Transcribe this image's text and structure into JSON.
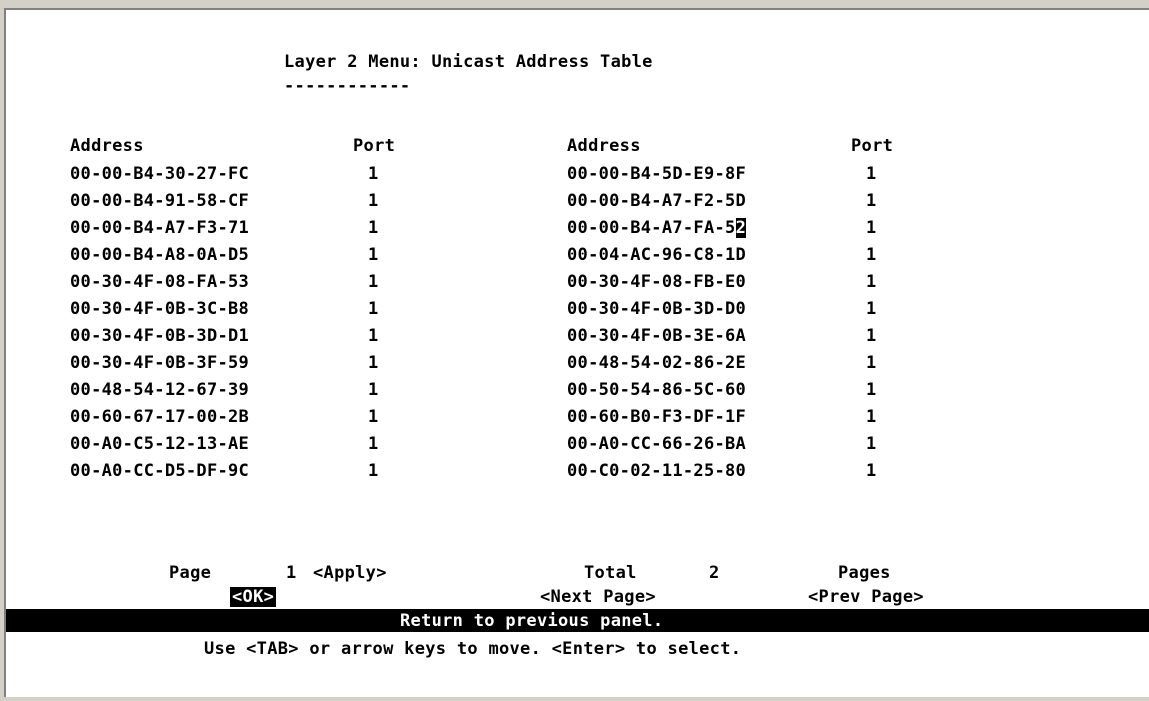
{
  "header": {
    "title": "Layer 2 Menu: Unicast Address Table",
    "underline": "------------"
  },
  "table": {
    "columns": [
      "Address",
      "Port",
      "Address",
      "Port"
    ],
    "rows": [
      [
        "00-00-B4-30-27-FC",
        "1",
        "00-00-B4-5D-E9-8F",
        "1"
      ],
      [
        "00-00-B4-91-58-CF",
        "1",
        "00-00-B4-A7-F2-5D",
        "1"
      ],
      [
        "00-00-B4-A7-F3-71",
        "1",
        "00-00-B4-A7-FA-52",
        "1"
      ],
      [
        "00-00-B4-A8-0A-D5",
        "1",
        "00-04-AC-96-C8-1D",
        "1"
      ],
      [
        "00-30-4F-08-FA-53",
        "1",
        "00-30-4F-08-FB-E0",
        "1"
      ],
      [
        "00-30-4F-0B-3C-B8",
        "1",
        "00-30-4F-0B-3D-D0",
        "1"
      ],
      [
        "00-30-4F-0B-3D-D1",
        "1",
        "00-30-4F-0B-3E-6A",
        "1"
      ],
      [
        "00-30-4F-0B-3F-59",
        "1",
        "00-48-54-02-86-2E",
        "1"
      ],
      [
        "00-48-54-12-67-39",
        "1",
        "00-50-54-86-5C-60",
        "1"
      ],
      [
        "00-60-67-17-00-2B",
        "1",
        "00-60-B0-F3-DF-1F",
        "1"
      ],
      [
        "00-A0-C5-12-13-AE",
        "1",
        "00-A0-CC-66-26-BA",
        "1"
      ],
      [
        "00-A0-CC-D5-DF-9C",
        "1",
        "00-C0-02-11-25-80",
        "1"
      ]
    ]
  },
  "pagination": {
    "page_label": "Page",
    "page_value": "1",
    "apply_label": "<Apply>",
    "total_label": "Total",
    "total_value": "2",
    "pages_label": "Pages"
  },
  "actions": {
    "ok_label": "<OK>",
    "next_label": "<Next Page>",
    "prev_label": "<Prev Page>"
  },
  "status": {
    "message": "Return to previous panel.",
    "help": "Use <TAB> or arrow keys to move. <Enter> to select."
  },
  "colors": {
    "background": "#ffffff",
    "text": "#000000",
    "highlight_bg": "#000000",
    "highlight_text": "#ffffff",
    "window_frame": "#d4d0c8"
  }
}
